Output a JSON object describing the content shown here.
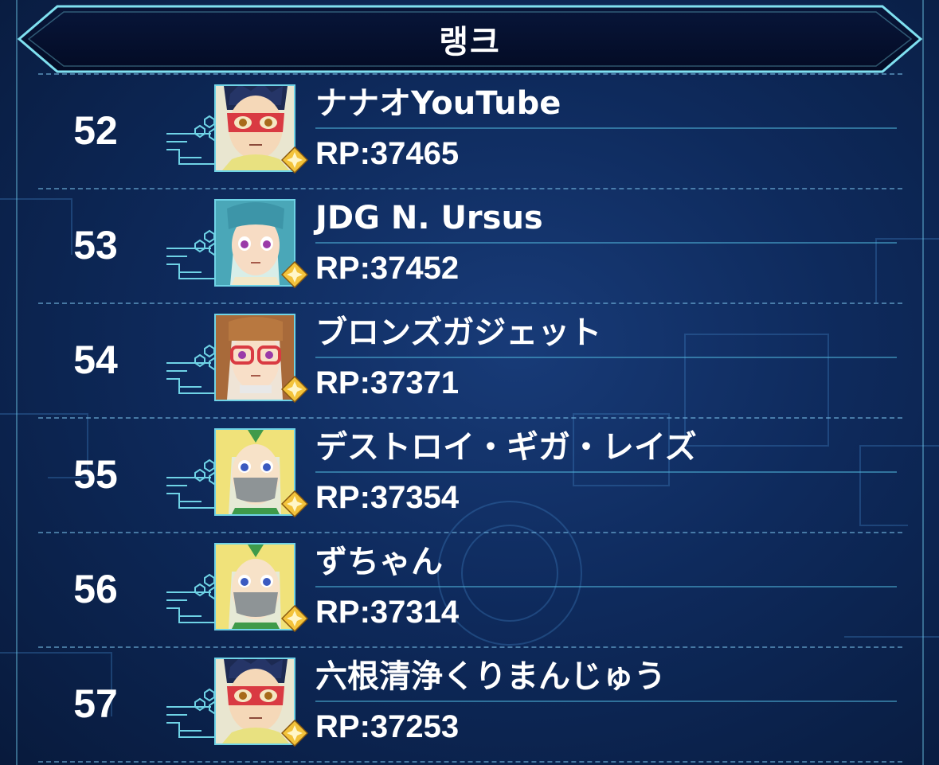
{
  "header": {
    "title": "랭크"
  },
  "colors": {
    "frame": "#6fd3e6",
    "badge_gold": "#f3c33b",
    "background": "#0e2a5c"
  },
  "icons": {
    "badge": "gold-diamond-rank-icon",
    "circuit": "circuit-panel-icon"
  },
  "entries": [
    {
      "rank": "52",
      "name": "ナナオYouTube",
      "rp": "RP:37465",
      "avatar": "boy-red-mask"
    },
    {
      "rank": "53",
      "name": "JDG N. Ursus",
      "rp": "RP:37452",
      "avatar": "teal-hair-girl"
    },
    {
      "rank": "54",
      "name": "ブロンズガジェット",
      "rp": "RP:37371",
      "avatar": "girl-red-glasses"
    },
    {
      "rank": "55",
      "name": "デストロイ・ギガ・レイズ",
      "rp": "RP:37354",
      "avatar": "blonde-masked"
    },
    {
      "rank": "56",
      "name": "ずちゃん",
      "rp": "RP:37314",
      "avatar": "blonde-masked"
    },
    {
      "rank": "57",
      "name": "六根清浄くりまんじゅう",
      "rp": "RP:37253",
      "avatar": "boy-red-mask"
    }
  ]
}
